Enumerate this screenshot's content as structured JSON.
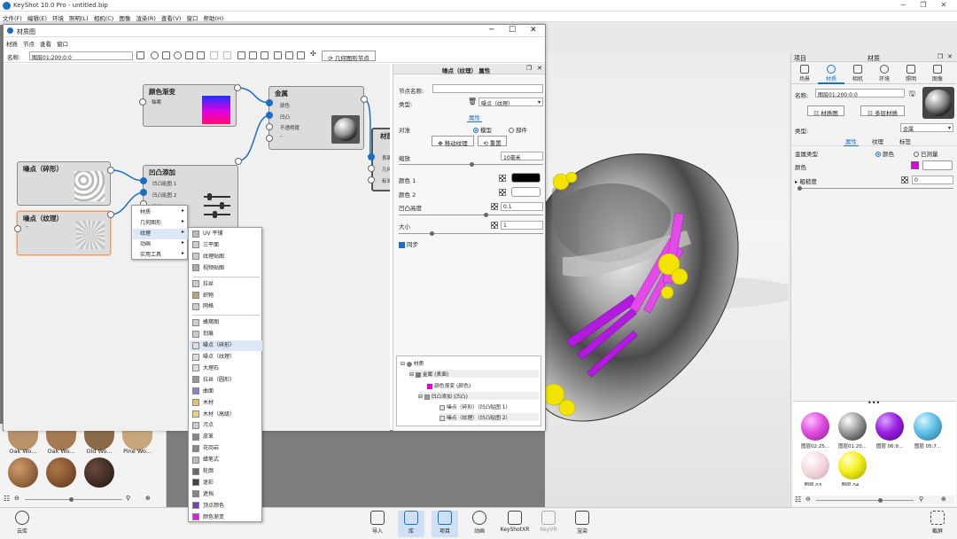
{
  "app": {
    "title": "KeyShot 10.0 Pro  -  untitled.bip"
  },
  "menubar": [
    "文件(F)",
    "编辑(E)",
    "环境",
    "照明(L)",
    "相机(C)",
    "图像",
    "渲染(R)",
    "查看(V)",
    "窗口",
    "帮助(H)"
  ],
  "graph_window": {
    "title": "材质图",
    "menu": [
      "材质",
      "节点",
      "查看",
      "窗口"
    ],
    "name_label": "名称:",
    "name_value": "图层01:200:0:0",
    "geometry_node_button": "几何图形节点",
    "nodes": {
      "color_gradient": {
        "title": "颜色渐变",
        "port": "轴案"
      },
      "metal": {
        "title": "金属",
        "ports": [
          "颜色",
          "凹凸",
          "不透明度",
          "“"
        ]
      },
      "bump_add": {
        "title": "凹凸添加",
        "ports": [
          "凹凸贴图 1",
          "凹凸贴图 2",
          "法线",
          "“"
        ]
      },
      "noise_fractal": {
        "title": "噪点（碎形）"
      },
      "noise_texture": {
        "title": "噪点（纹理）",
        "port": "“"
      },
      "material_out": {
        "title": "材质",
        "ports": [
          "表面",
          "几何",
          "标准"
        ]
      }
    }
  },
  "context_menu": {
    "items": [
      "材质",
      "几何图形",
      "纹理",
      "动画",
      "实用工具"
    ],
    "submenu": [
      "UV 平铺",
      "三平面",
      "纹理贴图",
      "视频贴图",
      "拉丝",
      "织物",
      "网格",
      "蜂窝图",
      "划痕",
      "噪点（碎形）",
      "噪点（纹理）",
      "大理石",
      "拉丝（圆形）",
      "曲面",
      "木材",
      "木材（高级）",
      "污点",
      "皮革",
      "花岗岩",
      "蜡笔式",
      "轮廓",
      "迷彩",
      "遮挡",
      "顶点颜色",
      "颜色渐变"
    ]
  },
  "props": {
    "title": "噪点（纹理）  属性",
    "node_name_label": "节点名称:",
    "type_label": "类型:",
    "type_value": "噪点（纹理）",
    "section": "属性",
    "mapping_label": "对准",
    "opt_model": "模型",
    "opt_part": "部件",
    "move_texture_btn": "移动纹理",
    "reset_btn": "重置",
    "scale_label": "缩放",
    "scale_value": "10毫米",
    "color1_label": "颜色 1",
    "color2_label": "颜色 2",
    "bump_height_label": "凹凸高度",
    "bump_height_value": "0.1",
    "size_label": "大小",
    "size_value": "1",
    "sync_label": "同步",
    "color1": "#000000",
    "color2": "#ffffff"
  },
  "tree": {
    "rows": [
      {
        "t": "材质",
        "lvl": 0
      },
      {
        "t": "金属 (表面)",
        "lvl": 1
      },
      {
        "t": "颜色渐变 (颜色)",
        "lvl": 2
      },
      {
        "t": "凹凸添加 (凹凸)",
        "lvl": 2
      },
      {
        "t": "噪点（碎形）（凹凸贴图 1）",
        "lvl": 3
      },
      {
        "t": "噪点（纹理）（凹凸贴图 2）",
        "lvl": 3
      }
    ]
  },
  "right_panel": {
    "title_left": "项目",
    "title_center": "材质",
    "tabs": [
      "场景",
      "材质",
      "相机",
      "环境",
      "照明",
      "图像"
    ],
    "name_label": "名称:",
    "name_value": "图层01:200:0:0",
    "graph_btn": "材质图",
    "multi_btn": "多层材质",
    "type_label": "类型:",
    "type_value": "金属",
    "sub_tabs": [
      "属性",
      "纹理",
      "标签"
    ],
    "metal_type_label": "金属类型",
    "opt_color": "颜色",
    "opt_measured": "已测量",
    "color_label": "颜色",
    "roughness_label": "粗糙度",
    "roughness_value": "0",
    "swatch": "#e000e0",
    "balls": [
      {
        "label": "图层02:25...",
        "color": "#e14de0"
      },
      {
        "label": "图层01:20...",
        "color": "#9a9a9a"
      },
      {
        "label": "图层 06:9...",
        "color": "#9a1fe0"
      },
      {
        "label": "图层 05:7...",
        "color": "#5fc0e8"
      },
      {
        "label": "图层 03...",
        "color": "#f3d6dc"
      },
      {
        "label": "图层 04...",
        "color": "#f3ef1a"
      }
    ]
  },
  "library": {
    "items": [
      {
        "label": "Oak Wo...",
        "color": "#b7926b"
      },
      {
        "label": "Oak Wo...",
        "color": "#a57a52"
      },
      {
        "label": "Old Wo...",
        "color": "#8b6a4a"
      },
      {
        "label": "Pine Wo...",
        "color": "#c8a67c"
      }
    ],
    "balls2": [
      "#a0703f",
      "#8a5a34",
      "#3b2a22"
    ]
  },
  "bottombar": {
    "left": "云库",
    "items": [
      "导入",
      "库",
      "项目",
      "动画",
      "KeyShotXR",
      "KeyVR",
      "渲染"
    ],
    "right": "截屏"
  }
}
